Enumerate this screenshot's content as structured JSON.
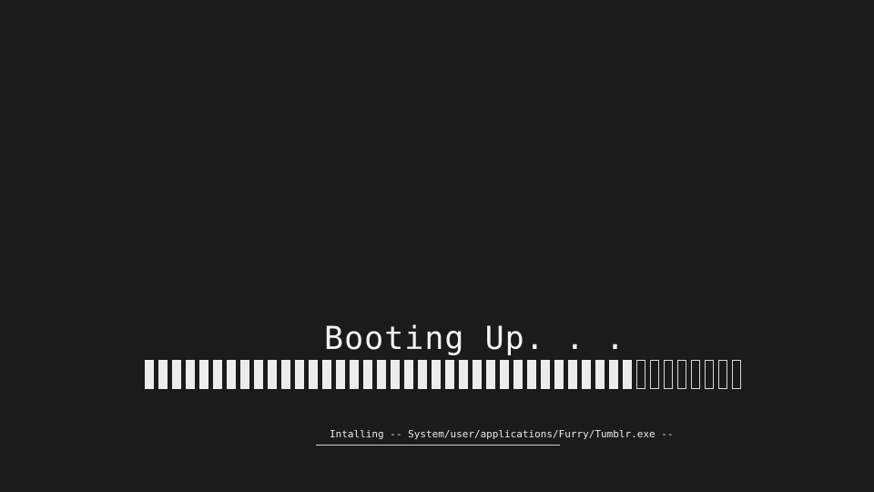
{
  "boot": {
    "title": "Booting Up. . .",
    "status_text": "Intalling -- System/user/applications/Furry/Tumblr.exe --"
  },
  "progress": {
    "filled_segments": 36,
    "total_segments": 44,
    "fraction": 0.818
  },
  "colors": {
    "background": "#1b1b1b",
    "foreground": "#f2f2f2"
  }
}
